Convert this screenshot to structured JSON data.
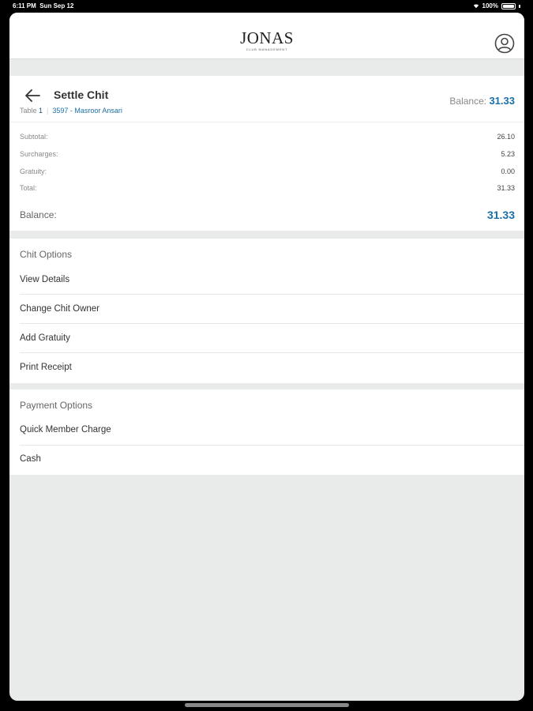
{
  "status": {
    "time": "6:11 PM",
    "date": "Sun Sep 12",
    "battery": "100%"
  },
  "header": {
    "logo": "JONAS",
    "logo_sub": "CLUB MANAGEMENT"
  },
  "chit": {
    "title": "Settle Chit",
    "table_label": "Table",
    "table_number": "1",
    "member": "3597 - Masroor Ansari",
    "balance_label": "Balance:",
    "balance_value": "31.33"
  },
  "totals": [
    {
      "label": "Subtotal:",
      "value": "26.10"
    },
    {
      "label": "Surcharges:",
      "value": "5.23"
    },
    {
      "label": "Gratuity:",
      "value": "0.00"
    },
    {
      "label": "Total:",
      "value": "31.33"
    }
  ],
  "balance": {
    "label": "Balance:",
    "value": "31.33"
  },
  "chit_options": {
    "title": "Chit Options",
    "items": [
      "View Details",
      "Change Chit Owner",
      "Add Gratuity",
      "Print Receipt"
    ]
  },
  "payment_options": {
    "title": "Payment Options",
    "items": [
      "Quick Member Charge",
      "Cash"
    ]
  },
  "colors": {
    "accent": "#1a6fa8",
    "background": "#e9ebeb"
  }
}
